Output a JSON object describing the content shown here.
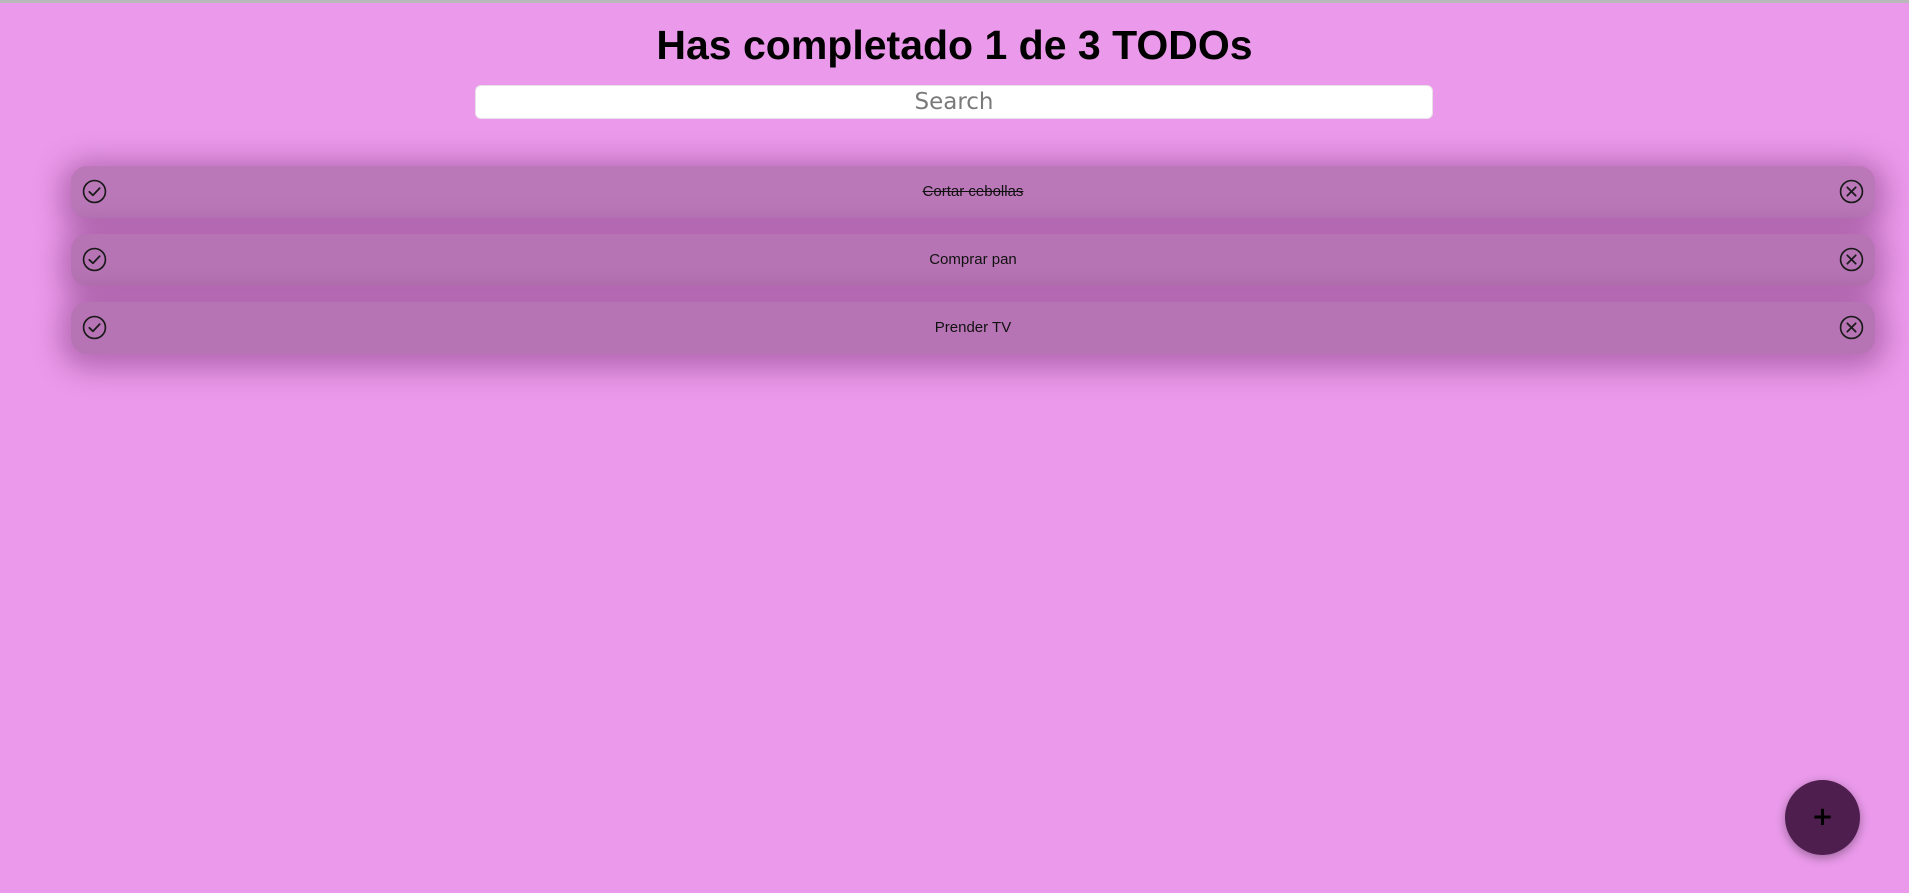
{
  "header": {
    "title": "Has completado 1 de 3 TODOs"
  },
  "search": {
    "placeholder": "Search",
    "value": ""
  },
  "todos": [
    {
      "text": "Cortar cebollas",
      "completed": true
    },
    {
      "text": "Comprar pan",
      "completed": false
    },
    {
      "text": "Prender TV",
      "completed": false
    }
  ],
  "icons": {
    "complete": "check-circle-icon",
    "delete": "close-circle-icon"
  },
  "fab": {
    "label": "+"
  },
  "colors": {
    "background": "#eb9aeb",
    "item": "#ba78b9",
    "fab": "#4e1f4e"
  }
}
